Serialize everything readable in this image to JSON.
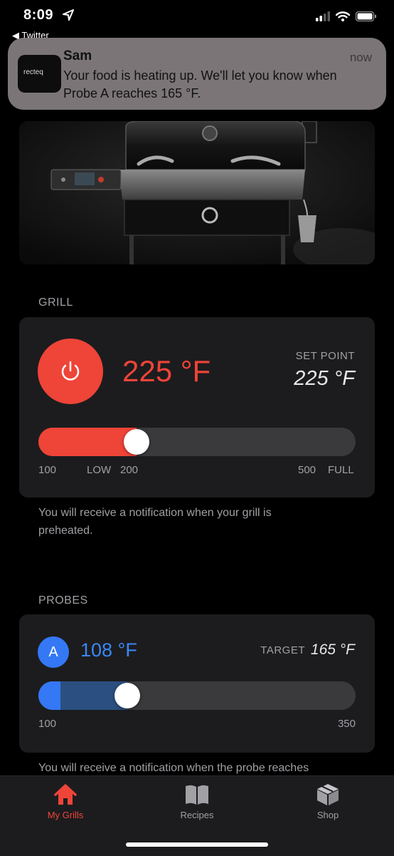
{
  "status_bar": {
    "time": "8:09",
    "back_app": "Twitter"
  },
  "notification": {
    "app_icon_text": "recteq",
    "sender": "Sam",
    "time": "now",
    "message": "Your food is heating up. We'll let you know when Probe A reaches 165 °F."
  },
  "grill": {
    "section_label": "GRILL",
    "current_temp": "225 °F",
    "setpoint_label": "SET POINT",
    "setpoint_value": "225 °F",
    "slider": {
      "min_label": "100",
      "low_label": "LOW",
      "low_value_label": "200",
      "max_label": "500",
      "full_label": "FULL",
      "level_percent": 31
    },
    "info": "You will receive a notification when your grill is preheated."
  },
  "probes": {
    "section_label": "PROBES",
    "probe_id": "A",
    "current_temp": "108 °F",
    "target_label": "TARGET",
    "target_value": "165 °F",
    "slider": {
      "min_label": "100",
      "max_label": "350",
      "current_percent": 7,
      "target_percent": 28
    },
    "info": "You will receive a notification when the probe reaches"
  },
  "tabs": [
    {
      "label": "My Grills",
      "icon": "home-icon",
      "active": true
    },
    {
      "label": "Recipes",
      "icon": "book-icon",
      "active": false
    },
    {
      "label": "Shop",
      "icon": "box-icon",
      "active": false
    }
  ],
  "colors": {
    "accent_red": "#ef4438",
    "probe_blue": "#3478f6",
    "card_bg": "#1c1c1e",
    "inactive_tab": "#a0a0a5"
  }
}
